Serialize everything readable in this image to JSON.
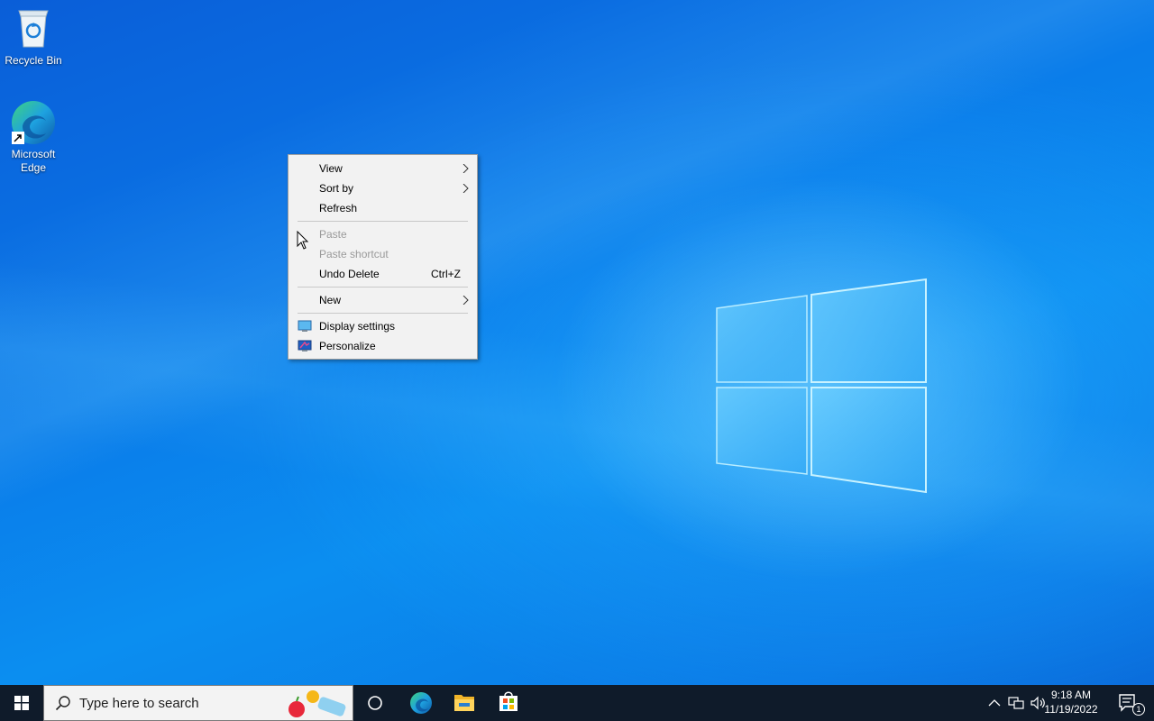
{
  "desktop": {
    "icons": [
      {
        "label": "Recycle Bin",
        "icon": "recycle-bin-icon"
      },
      {
        "label": "Microsoft Edge",
        "icon": "edge-icon"
      }
    ]
  },
  "context_menu": {
    "items": [
      {
        "label": "View",
        "submenu": true,
        "enabled": true
      },
      {
        "label": "Sort by",
        "submenu": true,
        "enabled": true
      },
      {
        "label": "Refresh",
        "enabled": true
      },
      {
        "label": "Paste",
        "enabled": false
      },
      {
        "label": "Paste shortcut",
        "enabled": false
      },
      {
        "label": "Undo Delete",
        "shortcut": "Ctrl+Z",
        "enabled": true
      },
      {
        "label": "New",
        "submenu": true,
        "enabled": true
      },
      {
        "label": "Display settings",
        "icon": "display-icon",
        "enabled": true
      },
      {
        "label": "Personalize",
        "icon": "personalize-icon",
        "enabled": true
      }
    ]
  },
  "taskbar": {
    "search_placeholder": "Type here to search",
    "pinned": [
      "task-view-icon",
      "edge-icon",
      "file-explorer-icon",
      "store-icon"
    ],
    "clock": {
      "time": "9:18 AM",
      "date": "11/19/2022"
    },
    "notification_count": "1"
  },
  "colors": {
    "taskbar": "#0f1b2a",
    "menu_bg": "#f2f2f2",
    "accent": "#0078d7"
  }
}
